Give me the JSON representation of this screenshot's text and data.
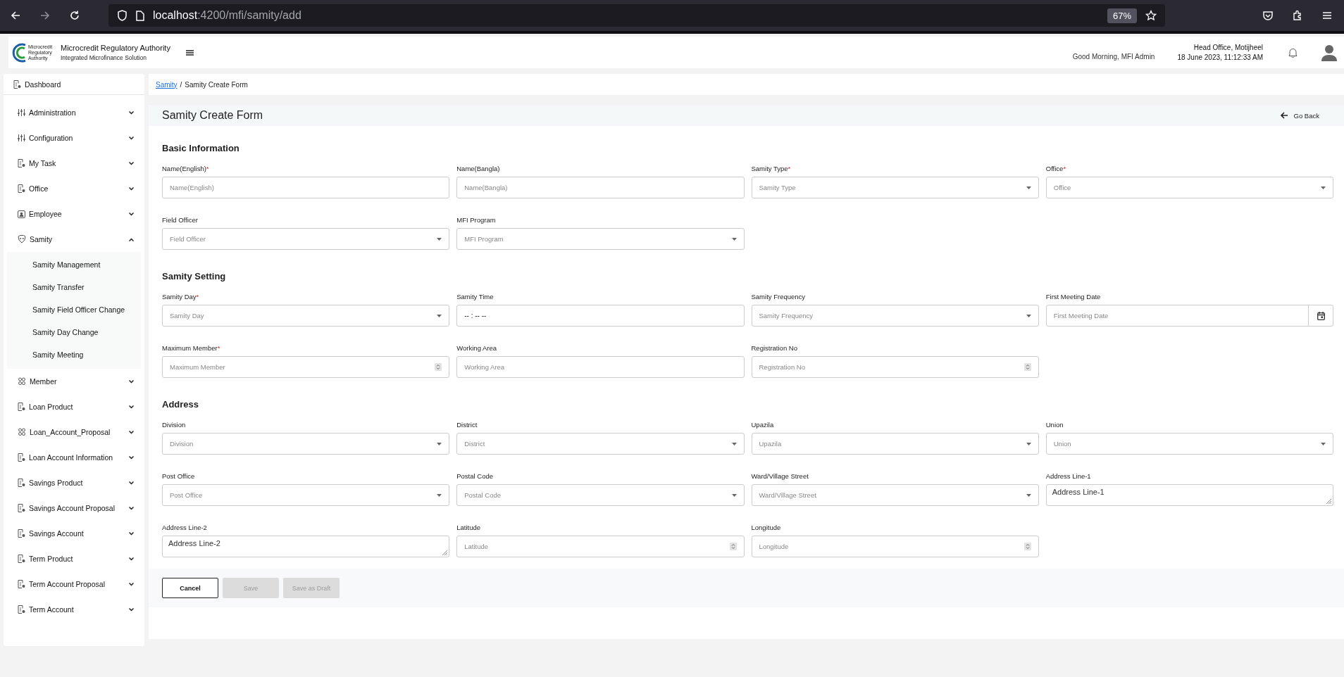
{
  "browser": {
    "url_host": "localhost",
    "url_path": ":4200/mfi/samity/add",
    "zoom": "67%"
  },
  "header": {
    "org_name": "Microcredit Regulatory Authority",
    "org_subtitle": "Integrated Microfinance Solution",
    "logo_text": "Microcredit Regulatory Authority",
    "greeting": "Good Morning, MFI Admin",
    "office": "Head Office, Motijheel",
    "datetime": "18 June 2023, 11:12:33 AM"
  },
  "sidebar": {
    "items": [
      {
        "label": "Dashboard",
        "kind": "top"
      },
      {
        "label": "Administration",
        "kind": "group",
        "expanded": false
      },
      {
        "label": "Configuration",
        "kind": "group",
        "expanded": false
      },
      {
        "label": "My Task",
        "kind": "group",
        "expanded": false
      },
      {
        "label": "Office",
        "kind": "group",
        "expanded": false
      },
      {
        "label": "Employee",
        "kind": "group",
        "expanded": false
      },
      {
        "label": "Samity",
        "kind": "group",
        "expanded": true,
        "children": [
          {
            "label": "Samity Management"
          },
          {
            "label": "Samity Transfer"
          },
          {
            "label": "Samity Field Officer Change"
          },
          {
            "label": "Samity Day Change"
          },
          {
            "label": "Samity Meeting"
          }
        ]
      },
      {
        "label": "Member",
        "kind": "group",
        "expanded": false
      },
      {
        "label": "Loan Product",
        "kind": "group",
        "expanded": false
      },
      {
        "label": "Loan_Account_Proposal",
        "kind": "group",
        "expanded": false
      },
      {
        "label": "Loan Account Information",
        "kind": "group",
        "expanded": false
      },
      {
        "label": "Savings Product",
        "kind": "group",
        "expanded": false
      },
      {
        "label": "Savings Account Proposal",
        "kind": "group",
        "expanded": false
      },
      {
        "label": "Savings Account",
        "kind": "group",
        "expanded": false
      },
      {
        "label": "Term Product",
        "kind": "group",
        "expanded": false
      },
      {
        "label": "Term Account Proposal",
        "kind": "group",
        "expanded": false
      },
      {
        "label": "Term Account",
        "kind": "group",
        "expanded": false
      }
    ]
  },
  "breadcrumb": {
    "link": "Samity",
    "separator": "/",
    "current": "Samity Create Form"
  },
  "form": {
    "title": "Samity Create Form",
    "back": "Go Back",
    "sections": [
      {
        "title": "Basic Information",
        "fields": [
          {
            "label": "Name(English)",
            "required_mark": "*",
            "kind": "text",
            "placeholder": "Name(English)"
          },
          {
            "label": "Name(Bangla)",
            "kind": "text",
            "placeholder": "Name(Bangla)"
          },
          {
            "label": "Samity Type",
            "required_mark": "*",
            "kind": "select",
            "placeholder": "Samity Type"
          },
          {
            "label": "Office",
            "required_mark": "*",
            "kind": "select",
            "placeholder": "Office"
          },
          {
            "label": "Field Officer",
            "kind": "select",
            "placeholder": "Field Officer"
          },
          {
            "label": "MFI Program",
            "kind": "select",
            "placeholder": "MFI Program"
          }
        ]
      },
      {
        "title": "Samity Setting",
        "fields": [
          {
            "label": "Samity Day",
            "required_mark": "*",
            "kind": "select",
            "placeholder": "Samity Day"
          },
          {
            "label": "Samity Time",
            "kind": "time",
            "placeholder": "-- : --  --"
          },
          {
            "label": "Samity Frequency",
            "kind": "select",
            "placeholder": "Samity Frequency"
          },
          {
            "label": "First Meeting Date",
            "kind": "date",
            "placeholder": "First Meeting Date"
          },
          {
            "label": "Maximum Member",
            "required_mark": "*",
            "kind": "number",
            "placeholder": "Maximum Member"
          },
          {
            "label": "Working Area",
            "kind": "text",
            "placeholder": "Working Area"
          },
          {
            "label": "Registration No",
            "kind": "number",
            "placeholder": "Registration No"
          }
        ]
      },
      {
        "title": "Address",
        "fields": [
          {
            "label": "Division",
            "kind": "select",
            "placeholder": "Division"
          },
          {
            "label": "District",
            "kind": "select",
            "placeholder": "District"
          },
          {
            "label": "Upazila",
            "kind": "select",
            "placeholder": "Upazila"
          },
          {
            "label": "Union",
            "kind": "select",
            "placeholder": "Union"
          },
          {
            "label": "Post Office",
            "kind": "select",
            "placeholder": "Post Office"
          },
          {
            "label": "Postal Code",
            "kind": "select",
            "placeholder": "Postal Code"
          },
          {
            "label": "Ward/Village Street",
            "kind": "select",
            "placeholder": "Ward/Village Street"
          },
          {
            "label": "Address Line-1",
            "kind": "textarea",
            "placeholder": "Address Line-1"
          },
          {
            "label": "Address Line-2",
            "kind": "textarea",
            "placeholder": "Address Line-2"
          },
          {
            "label": "Latitude",
            "kind": "number",
            "placeholder": "Latitude"
          },
          {
            "label": "Longitude",
            "kind": "number",
            "placeholder": "Longitude"
          }
        ]
      }
    ],
    "buttons": [
      {
        "label": "Cancel",
        "disabled": false
      },
      {
        "label": "Save",
        "disabled": true
      },
      {
        "label": "Save as Draft",
        "disabled": true
      }
    ]
  }
}
